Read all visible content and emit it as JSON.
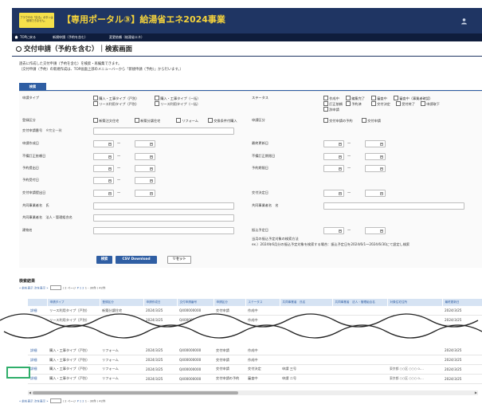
{
  "header": {
    "notice": "ブラウザの「戻る」ボタンは使用できません。",
    "title": "【専用ポータル③】給湯省エネ2024事業",
    "user_icon": "user-icon"
  },
  "nav": {
    "home": "TOPに戻る",
    "new_apply": "新規申請（予約を含む）",
    "change": "変更依頼（給湯省エネ）",
    "home_icon": "home-icon"
  },
  "page_title": "交付申請（予約を含む）｜検索画面",
  "intro": [
    "過去に作成した交付申請（予約を含む）を検索・再編集できます。",
    "（交付申請（予約）の新規作成は、TOP画面上部のメニューバーから「新規申請（予約）」から行います。）"
  ],
  "tab": "検索",
  "form": {
    "apply_type": {
      "label": "申請タイプ",
      "options": [
        "購入・工事タイプ（戸別）",
        "購入・工事タイプ（一括）",
        "リース利用タイプ（戸別）",
        "リース利用タイプ（一括）"
      ]
    },
    "status": {
      "label": "ステータス",
      "options": [
        "作成中",
        "編集完了",
        "審査中",
        "審査中（事業者確認）",
        "訂正依頼",
        "予約済",
        "交付決定",
        "受付終了",
        "申請取下",
        "辞申請"
      ]
    },
    "reg_type": {
      "label": "登録区分",
      "options": [
        "新築注文住宅",
        "新築分譲住宅",
        "リフォーム",
        "交換条件付購入"
      ]
    },
    "apply_kubun": {
      "label": "申請区分",
      "options": [
        "交付申請の予約",
        "交付申請"
      ]
    },
    "apply_no": {
      "label": "交付申請番号",
      "hint": "※完全一致"
    },
    "created": {
      "label": "申請作成日"
    },
    "updated": {
      "label": "最終更新日"
    },
    "fix_req": {
      "label": "不備訂正依頼日"
    },
    "fix_done": {
      "label": "不備訂正期限日"
    },
    "reserve_submit": {
      "label": "予約提出日"
    },
    "reserve_accept": {
      "label": "予約受付日"
    },
    "reserve_expire": {
      "label": "予約期限日"
    },
    "apply_submit": {
      "label": "交付申請提出日"
    },
    "grant_date": {
      "label": "交付決定日"
    },
    "joint_name": {
      "label": "共同事業者名　氏"
    },
    "joint_name2": {
      "label": "共同事業者名　名"
    },
    "joint_corp": {
      "label": "共同事業者名　法人・管理組合名"
    },
    "building": {
      "label": "建物名"
    },
    "transfer": {
      "label": "振込予定日"
    },
    "transfer_note": [
      "当月の振込予定対象の検索方法",
      "ex.）2024年6月分の振込予定対象を検索する場合：振込予定日を2024/6/1～2024/6/30にて設定し検索"
    ],
    "tilde": "～"
  },
  "buttons": {
    "search": "検索",
    "csv": "CSV Download",
    "reset": "リセット"
  },
  "results": {
    "title": "検索結果",
    "pager": {
      "first": "« 前を表示",
      "prev": "次を表示 »",
      "of_page": "/ 2 ページ",
      "pages": "P 1 2",
      "range": "1 - 30件 / 42件"
    },
    "columns": [
      "",
      "申請タイプ",
      "登録区分",
      "申請作成日",
      "交付申請番号",
      "申請区分",
      "ステータス",
      "共同事業者　氏名",
      "共同事業者　法人・管理組合名",
      "対象住宅住所",
      "最終更新日"
    ],
    "top_rows": [
      [
        "詳細",
        "リース利用タイプ（戸別）",
        "新築分譲住宅",
        "2024/3/25",
        "Q400000000",
        "交付申請",
        "作成中",
        "",
        "",
        "",
        "2024/3/25"
      ],
      [
        "詳細",
        "リース利用タイプ（戸別）",
        "リフォーム",
        "2024/3/25",
        "Q400000000",
        "交付申請",
        "作成中",
        "",
        "",
        "",
        "2024/3/25"
      ]
    ],
    "bottom_rows": [
      [
        "詳細",
        "購入・工事タイプ（戸別）",
        "リフォーム",
        "2024/3/25",
        "Q400000000",
        "交付申請",
        "作成中",
        "",
        "",
        "",
        "2024/3/25"
      ],
      [
        "詳細",
        "購入・工事タイプ（戸別）",
        "リフォーム",
        "2024/3/25",
        "Q400000000",
        "交付申請",
        "作成中",
        "",
        "",
        "",
        "2024/3/25"
      ],
      [
        "詳細",
        "購入・工事タイプ（戸別）",
        "リフォーム",
        "2024/3/25",
        "Q400000000",
        "交付申請",
        "交付決定",
        "申請 三号",
        "",
        "東京都 ○○区 ○○○ 0-...",
        "2024/3/25"
      ],
      [
        "詳細",
        "購入・工事タイプ（戸別）",
        "リフォーム",
        "2024/3/25",
        "Q400000000",
        "交付申請の予約",
        "審査中",
        "申請 二号",
        "",
        "東京都 ○○区 ○○○ 0-...",
        "2024/3/25"
      ]
    ]
  },
  "colors": {
    "navy": "#1f3563",
    "yellow": "#f5d33b",
    "blue": "#2f5ea3",
    "highlight": "#2fae6a"
  }
}
